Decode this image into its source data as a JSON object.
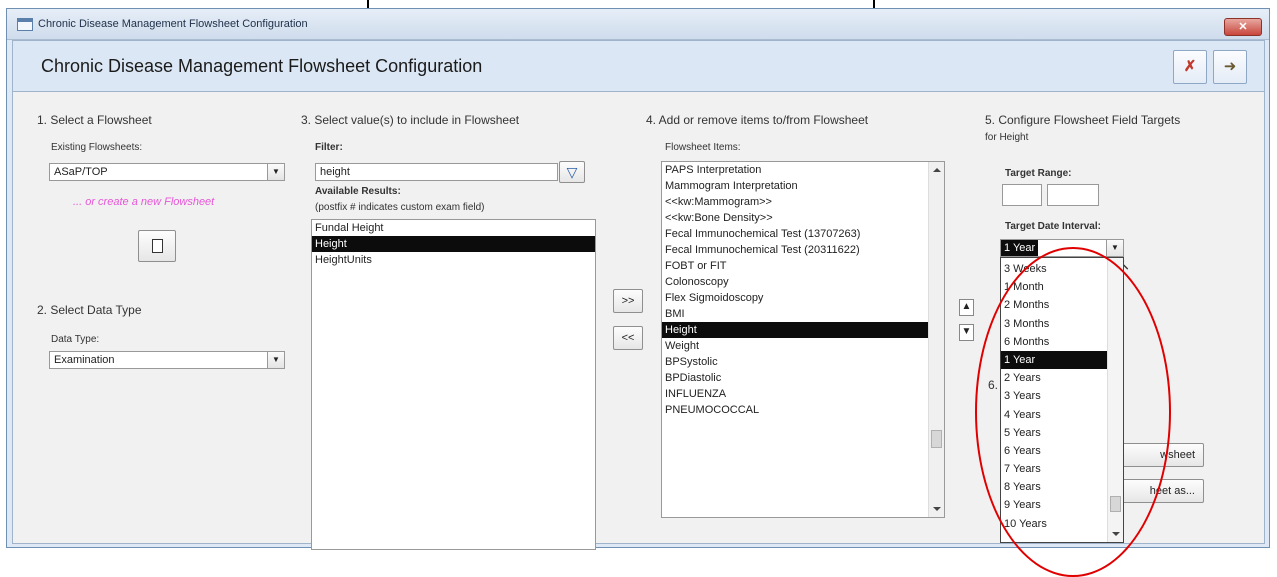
{
  "window": {
    "title": "Chronic Disease Management Flowsheet Configuration",
    "close_glyph": "✕"
  },
  "header": {
    "title": "Chronic Disease Management Flowsheet Configuration",
    "cancel_icon": "✗",
    "exit_icon": "➜"
  },
  "section1": {
    "heading": "1. Select a  Flowsheet",
    "existing_label": "Existing Flowsheets:",
    "existing_value": "ASaP/TOP",
    "create_new": "... or create a new  Flowsheet"
  },
  "section2": {
    "heading": "2. Select Data Type",
    "type_label": "Data Type:",
    "type_value": "Examination"
  },
  "section3": {
    "heading": "3. Select value(s) to include in Flowsheet",
    "filter_label": "Filter:",
    "filter_value": "height",
    "available_label": "Available Results:",
    "postfix_note": "(postfix # indicates custom exam field)",
    "results": [
      "Fundal Height",
      "Height",
      "HeightUnits"
    ],
    "selected_index": 1
  },
  "transfer": {
    "add_label": ">>",
    "remove_label": "<<"
  },
  "section4": {
    "heading": "4. Add or remove items to/from Flowsheet",
    "items_label": "Flowsheet Items:",
    "items": [
      "PAPS Interpretation",
      "Mammogram Interpretation",
      "<<kw:Mammogram>>",
      "<<kw:Bone Density>>",
      "Fecal Immunochemical Test (13707263)",
      "Fecal Immunochemical Test (20311622)",
      "FOBT or FIT",
      "Colonoscopy",
      "Flex Sigmoidoscopy",
      "BMI",
      "Height",
      "Weight",
      "BPSystolic",
      "BPDiastolic",
      "INFLUENZA",
      "PNEUMOCOCCAL"
    ],
    "selected_index": 10
  },
  "section5": {
    "heading": "5. Configure Flowsheet Field Targets",
    "subheading": "for Height",
    "target_range_label": "Target Range:",
    "target_date_label": "Target Date Interval:",
    "selected_interval": "1 Year",
    "interval_options": [
      "3 Weeks",
      "1 Month",
      "2 Months",
      "3 Months",
      "6 Months",
      "1 Year",
      "2 Years",
      "3 Years",
      "4 Years",
      "5 Years",
      "6 Years",
      "7 Years",
      "8 Years",
      "9 Years",
      "10 Years"
    ],
    "selected_option_index": 5,
    "section6_number": "6.",
    "flowsheet_button_partial": "wsheet",
    "save_as_button_partial": "heet as..."
  }
}
